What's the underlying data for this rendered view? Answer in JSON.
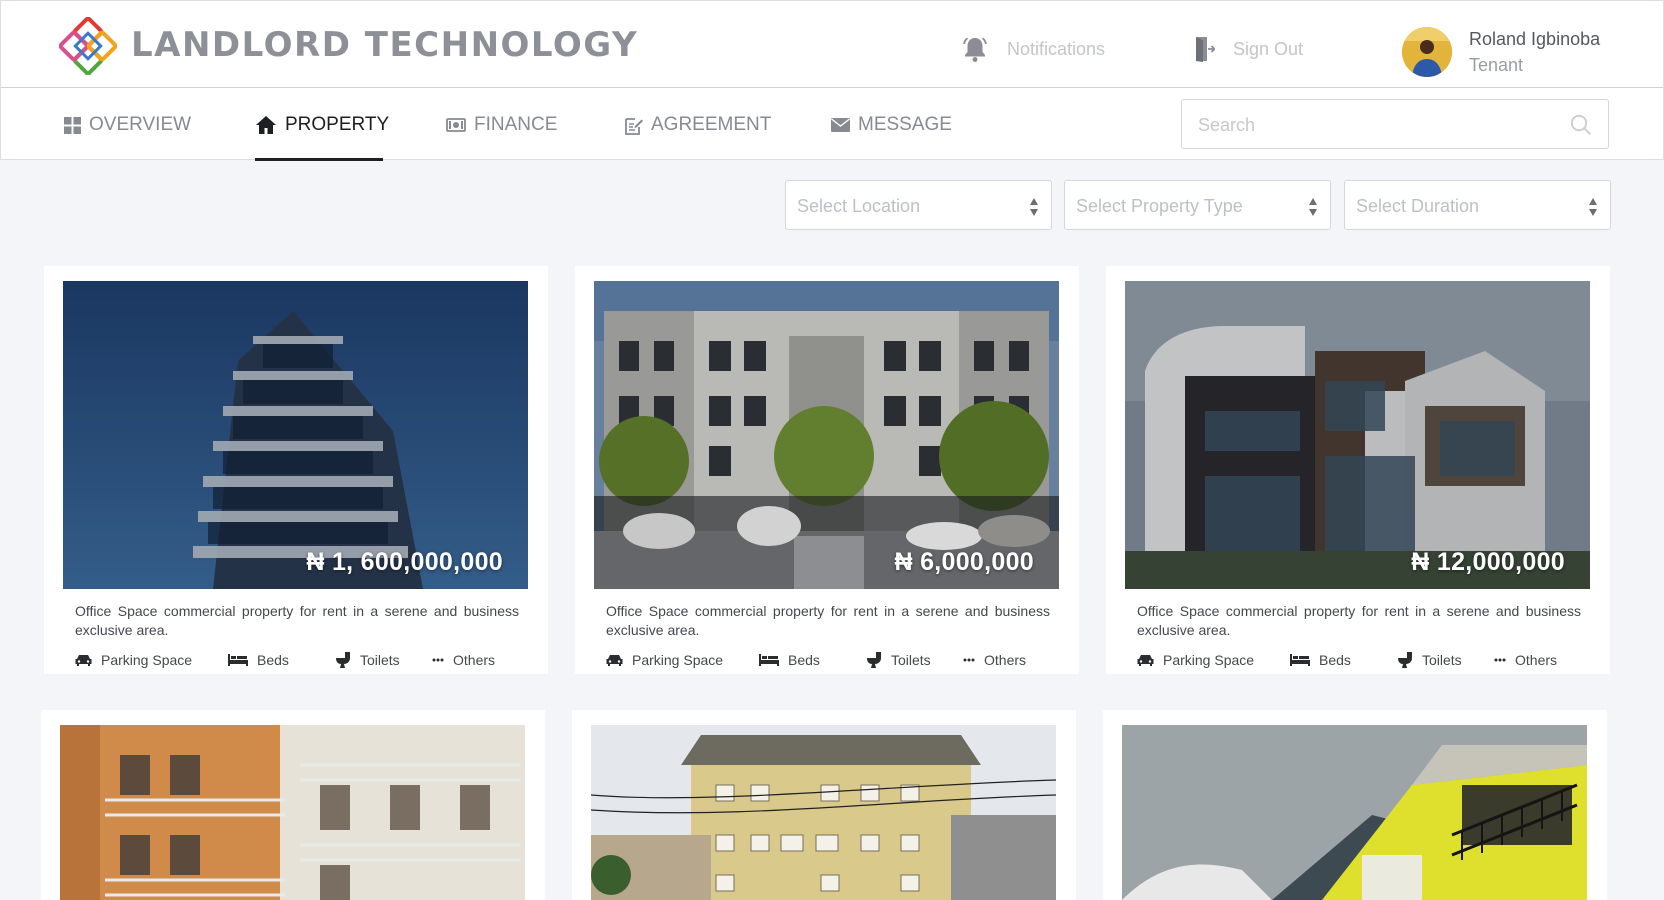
{
  "app": {
    "brand": "LANDLORD TECHNOLOGY"
  },
  "header": {
    "notifications_label": "Notifications",
    "signout_label": "Sign Out",
    "user": {
      "name": "Roland Igbinoba",
      "role": "Tenant"
    }
  },
  "nav": {
    "items": [
      {
        "label": "OVERVIEW",
        "icon": "grid-icon"
      },
      {
        "label": "PROPERTY",
        "icon": "home-icon",
        "active": true
      },
      {
        "label": "FINANCE",
        "icon": "money-icon"
      },
      {
        "label": "AGREEMENT",
        "icon": "edit-document-icon"
      },
      {
        "label": "MESSAGE",
        "icon": "envelope-icon"
      }
    ],
    "search_placeholder": "Search"
  },
  "filters": {
    "location_placeholder": "Select Location",
    "type_placeholder": "Select Property Type",
    "duration_placeholder": "Select Duration"
  },
  "properties": [
    {
      "price": "₦ 1, 600,000,000",
      "description": "Office Space commercial property for rent in a serene and business exclusive area.",
      "features": [
        "Parking Space",
        "Beds",
        "Toilets",
        "Others"
      ]
    },
    {
      "price": "₦ 6,000,000",
      "description": "Office Space commercial property for rent in a serene and business exclusive area.",
      "features": [
        "Parking Space",
        "Beds",
        "Toilets",
        "Others"
      ]
    },
    {
      "price": "₦ 12,000,000",
      "description": "Office Space commercial property for rent in a serene and business exclusive area.",
      "features": [
        "Parking Space",
        "Beds",
        "Toilets",
        "Others"
      ]
    },
    {
      "price": "",
      "description": "",
      "features": []
    },
    {
      "price": "",
      "description": "",
      "features": []
    },
    {
      "price": "",
      "description": "",
      "features": []
    }
  ],
  "colors": {
    "page_bg": "#f4f5f9",
    "brand_text": "#8d9096",
    "active_nav": "#1e1f22",
    "muted_text": "#c3c5cb"
  }
}
